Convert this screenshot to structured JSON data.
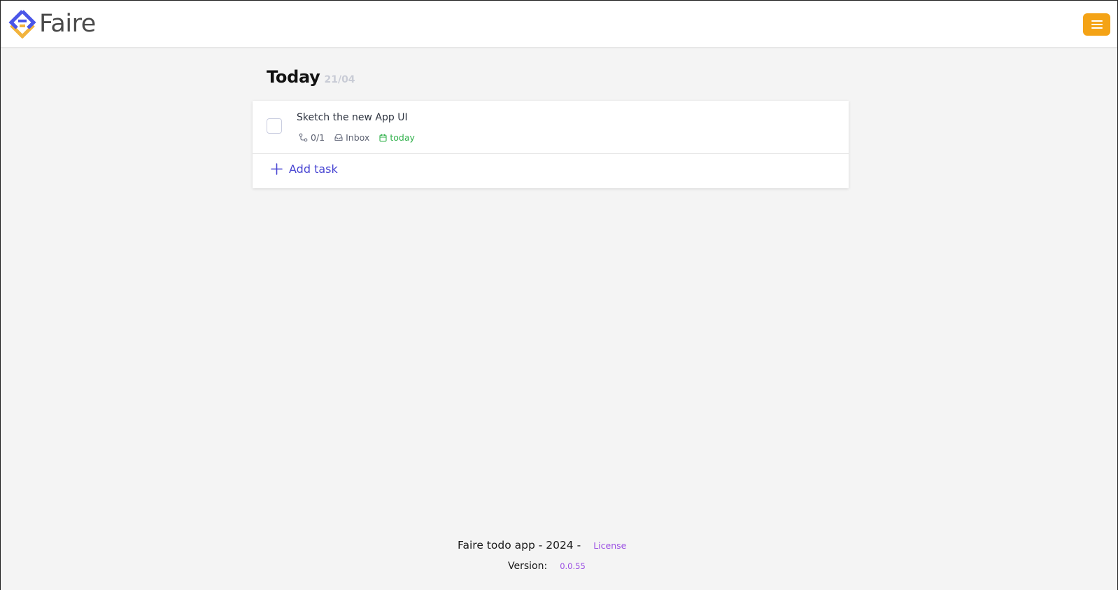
{
  "header": {
    "brand": "Faire",
    "brand_icon": "faire-logo-icon",
    "menu_icon": "hamburger-menu-icon",
    "colors": {
      "brand_blue": "#4a56e8",
      "brand_yellow": "#f2b33d",
      "menu_button": "#f4a316"
    }
  },
  "main": {
    "title": "Today",
    "date": "21/04",
    "tasks": [
      {
        "title": "Sketch the new App UI",
        "subtasks": "0/1",
        "project": "Inbox",
        "due": "today",
        "icons": [
          "subtask-icon",
          "inbox-icon",
          "calendar-icon"
        ]
      }
    ],
    "add_task_label": "Add task",
    "colors": {
      "accent": "#4845d2",
      "due_today": "#2fb04a"
    }
  },
  "footer": {
    "text": "Faire todo app - 2024 -",
    "license_label": "License",
    "version_label": "Version:",
    "version_value": "0.0.55",
    "colors": {
      "link": "#9b4fe3"
    }
  }
}
